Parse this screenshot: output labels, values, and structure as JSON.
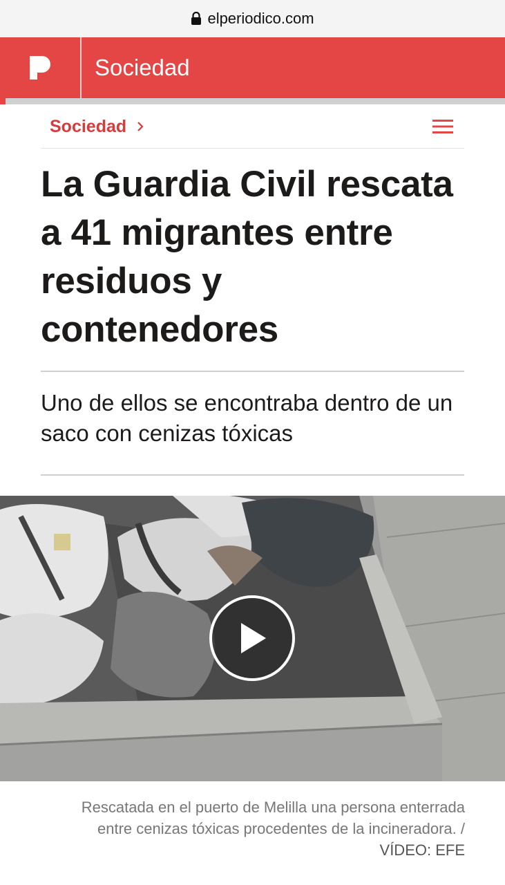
{
  "browser": {
    "url": "elperiodico.com"
  },
  "header": {
    "logo_letter": "P",
    "section": "Sociedad"
  },
  "breadcrumb": {
    "section": "Sociedad"
  },
  "article": {
    "headline": "La Guardia Civil rescata a 41 migrantes entre residuos y contenedores",
    "subtitle": "Uno de ellos se encontraba dentro de un saco con cenizas tóxicas",
    "caption": "Rescatada en el puerto de Melilla una persona enterrada entre cenizas tóxicas procedentes de la incineradora. /",
    "credit": "VÍDEO: EFE"
  },
  "colors": {
    "brand": "#e44646",
    "section_link": "#d63c3c",
    "text": "#1d1a1a"
  },
  "icons": [
    "lock-icon",
    "logo-p-icon",
    "chevron-right-icon",
    "hamburger-menu-icon",
    "play-icon"
  ]
}
